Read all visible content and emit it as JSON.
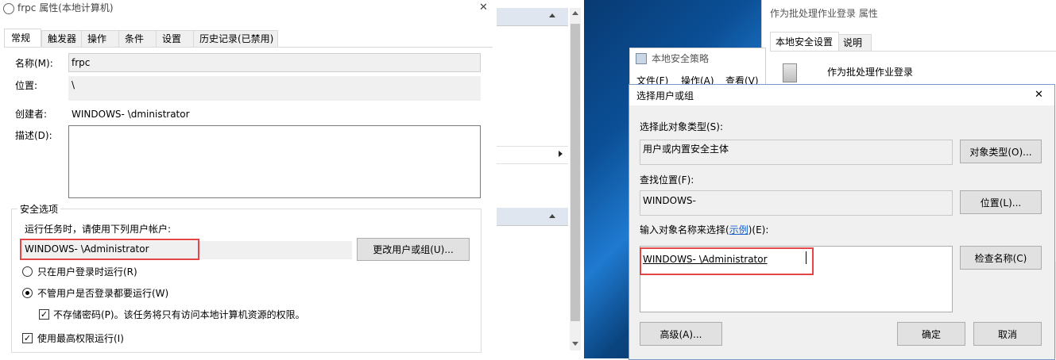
{
  "frpc_dialog": {
    "title": "frpc 属性(本地计算机)",
    "close_glyph": "✕",
    "tabs": [
      "常规",
      "触发器",
      "操作",
      "条件",
      "设置",
      "历史记录(已禁用)"
    ],
    "name_label": "名称(M):",
    "name_value": "frpc",
    "location_label": "位置:",
    "location_value": "\\",
    "author_label": "创建者:",
    "author_value": "WINDOWS-                \\dministrator",
    "description_label": "描述(D):",
    "security_group_label": "安全选项",
    "run_as_prompt": "运行任务时，请使用下列用户帐户:",
    "run_as_value": "WINDOWS-              \\Administrator",
    "change_user_button": "更改用户或组(U)...",
    "radio_logged_on": "只在用户登录时运行(R)",
    "radio_whether": "不管用户是否登录都要运行(W)",
    "check_no_password": "不存储密码(P)。该任务将只有访问本地计算机资源的权限。",
    "check_highest": "使用最高权限运行(I)"
  },
  "props_window": {
    "title": "作为批处理作业登录 属性",
    "tabs": [
      "本地安全设置",
      "说明"
    ],
    "policy_name": "作为批处理作业登录"
  },
  "policy_window": {
    "title": "本地安全策略",
    "menu": [
      "文件(F)",
      "操作(A)",
      "查看(V)"
    ]
  },
  "select_dialog": {
    "title": "选择用户或组",
    "close_glyph": "✕",
    "object_type_label": "选择此对象类型(S):",
    "object_type_value": "用户或内置安全主体",
    "object_type_button": "对象类型(O)...",
    "location_label": "查找位置(F):",
    "location_value": "WINDOWS-",
    "location_button": "位置(L)...",
    "enter_names_label_prefix": "输入对象名称来选择(",
    "enter_names_link": "示例",
    "enter_names_label_suffix": ")(E):",
    "names_value": "WINDOWS-              \\Administrator",
    "check_names_button": "检查名称(C)",
    "advanced_button": "高级(A)...",
    "ok_button": "确定",
    "cancel_button": "取消"
  },
  "colors": {
    "highlight_box": "#e24646",
    "link": "#1a5ec7",
    "dialog_bg": "#f0f0f0"
  }
}
